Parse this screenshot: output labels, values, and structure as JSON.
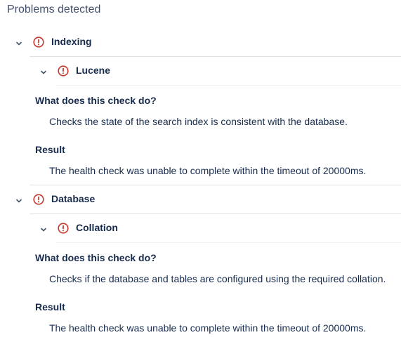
{
  "page_title": "Problems detected",
  "colors": {
    "error": "#c9372c",
    "text": "#172b4d",
    "muted": "#42526e",
    "divider": "#dfe1e6"
  },
  "groups": [
    {
      "title": "Indexing",
      "icon": "error-icon",
      "checks": [
        {
          "title": "Lucene",
          "icon": "error-icon",
          "what_heading": "What does this check do?",
          "what_text": "Checks the state of the search index is consistent with the database.",
          "result_heading": "Result",
          "result_text": "The health check was unable to complete within the timeout of 20000ms."
        }
      ]
    },
    {
      "title": "Database",
      "icon": "error-icon",
      "checks": [
        {
          "title": "Collation",
          "icon": "error-icon",
          "what_heading": "What does this check do?",
          "what_text": "Checks if the database and tables are configured using the required collation.",
          "result_heading": "Result",
          "result_text": "The health check was unable to complete within the timeout of 20000ms."
        }
      ]
    }
  ]
}
